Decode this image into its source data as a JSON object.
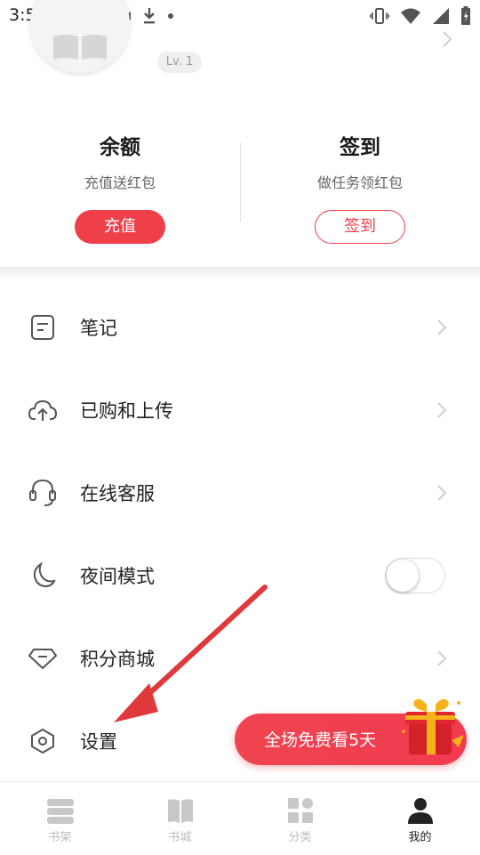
{
  "status_bar": {
    "time": "3:52"
  },
  "profile": {
    "level": "Lv. 1"
  },
  "card": {
    "balance": {
      "title": "余额",
      "subtitle": "充值送红包",
      "button": "充值"
    },
    "signin": {
      "title": "签到",
      "subtitle": "做任务领红包",
      "button": "签到"
    }
  },
  "menu": {
    "items": [
      {
        "label": "笔记",
        "icon": "note-icon"
      },
      {
        "label": "已购和上传",
        "icon": "cloud-upload-icon"
      },
      {
        "label": "在线客服",
        "icon": "headset-icon"
      },
      {
        "label": "夜间模式",
        "icon": "moon-icon",
        "toggle": false
      },
      {
        "label": "积分商城",
        "icon": "diamond-icon"
      },
      {
        "label": "设置",
        "icon": "settings-hexagon-icon"
      }
    ]
  },
  "promo": {
    "text": "全场免费看5天"
  },
  "tabbar": {
    "tabs": [
      {
        "label": "书架",
        "icon": "bookshelf-icon"
      },
      {
        "label": "书城",
        "icon": "book-icon"
      },
      {
        "label": "分类",
        "icon": "category-icon"
      },
      {
        "label": "我的",
        "icon": "person-icon",
        "active": true
      }
    ]
  },
  "colors": {
    "accent": "#ef3f4b",
    "text": "#222222",
    "muted": "#bdbdbd",
    "annotation_arrow": "#e0393c"
  }
}
